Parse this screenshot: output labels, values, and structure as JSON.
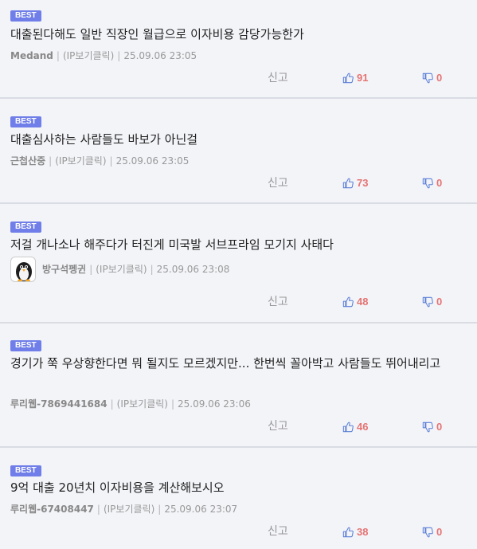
{
  "badge": "BEST",
  "report_label": "신고",
  "comments": [
    {
      "text": "대출된다해도 일반 직장인 월급으로 이자비용 감당가능한가",
      "author": "Medand",
      "ip": "(IP보기클릭)",
      "time": "25.09.06 23:05",
      "up": "91",
      "down": "0"
    },
    {
      "text": "대출심사하는 사람들도 바보가 아닌걸",
      "author": "근첩산중",
      "ip": "(IP보기클릭)",
      "time": "25.09.06 23:05",
      "up": "73",
      "down": "0"
    },
    {
      "text": "저걸 개나소나 해주다가 터진게 미국발 서브프라임 모기지 사태다",
      "author": "방구석펭귄",
      "ip": "(IP보기클릭)",
      "time": "25.09.06 23:08",
      "up": "48",
      "down": "0",
      "avatar": "penguin-avatar"
    },
    {
      "text": "경기가 쭉 우상향한다면 뭐 될지도 모르겠지만... 한번씩 꼴아박고 사람들도 뛰어내리고",
      "author": "루리웹-7869441684",
      "ip": "(IP보기클릭)",
      "time": "25.09.06 23:06",
      "up": "46",
      "down": "0"
    },
    {
      "text": "9억 대출 20년치 이자비용을 계산해보시오",
      "author": "루리웹-67408447",
      "ip": "(IP보기클릭)",
      "time": "25.09.06 23:07",
      "up": "38",
      "down": "0"
    }
  ],
  "colors": {
    "badge": "#6f7ee8",
    "thumb_up": "#5b7fd6",
    "thumb_down": "#5b7fd6",
    "count": "#e57373"
  }
}
